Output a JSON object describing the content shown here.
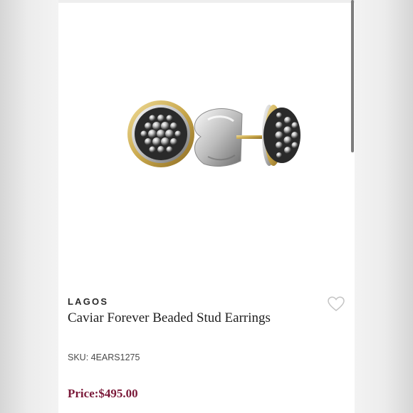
{
  "product": {
    "brand": "LAGOS",
    "title": "Caviar Forever Beaded Stud Earrings",
    "sku": "SKU: 4EARS1275",
    "price": "Price:$495.00",
    "image_icon": "earring-stud-image",
    "wishlist_icon": "heart-outline-icon"
  },
  "colors": {
    "price": "#7a1838",
    "gold": "#c9a84c",
    "silver": "#a8a8a8"
  }
}
